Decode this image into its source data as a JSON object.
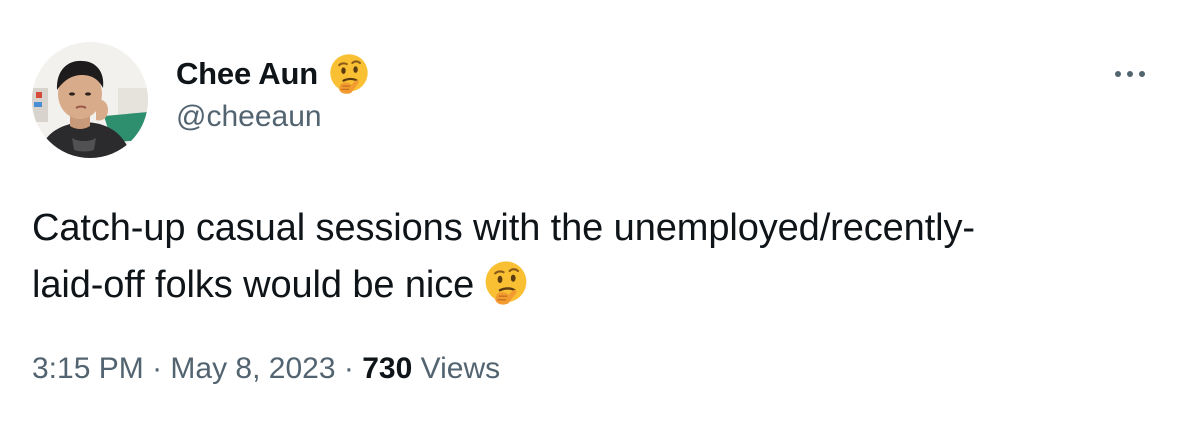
{
  "author": {
    "display_name": "Chee Aun",
    "name_emoji": "thinking-face-emoji",
    "handle": "@cheeaun"
  },
  "tweet": {
    "text_line1": "Catch-up casual sessions with the unemployed/recently-",
    "text_line2": "laid-off folks would be nice",
    "text_emoji": "thinking-face-emoji"
  },
  "meta": {
    "time": "3:15 PM",
    "separator": "·",
    "date": "May 8, 2023",
    "views_count": "730",
    "views_label": "Views"
  },
  "icons": {
    "more": "more-horizontal-icon"
  },
  "colors": {
    "primary_text": "#0f1419",
    "secondary_text": "#536471",
    "emoji_face": "#f9c033",
    "emoji_hand": "#f29b30"
  }
}
